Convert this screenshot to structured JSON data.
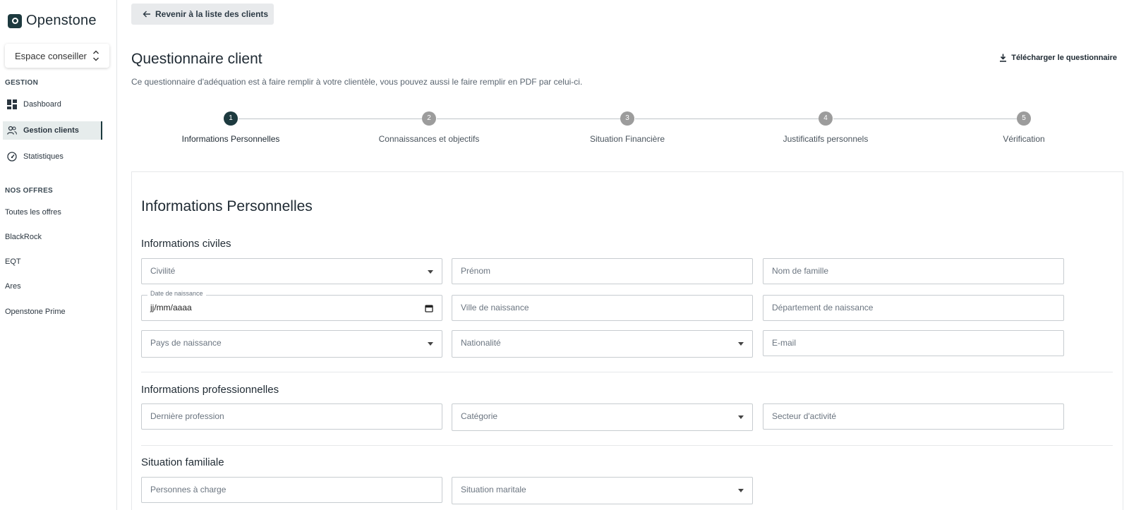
{
  "sidebar": {
    "logo": "Openstone",
    "space_select": "Espace conseiller",
    "section_gestion": "GESTION",
    "nav": [
      {
        "label": "Dashboard",
        "icon": "dashboard-icon"
      },
      {
        "label": "Gestion clients",
        "icon": "users-icon",
        "active": true
      },
      {
        "label": "Statistiques",
        "icon": "gauge-icon"
      }
    ],
    "section_offres": "NOS OFFRES",
    "offers": [
      "Toutes les offres",
      "BlackRock",
      "EQT",
      "Ares",
      "Openstone Prime"
    ]
  },
  "header": {
    "back_label": "Revenir à la liste des clients",
    "title": "Questionnaire client",
    "description": "Ce questionnaire d'adéquation est à faire remplir à votre clientèle, vous pouvez aussi le faire remplir en PDF par celui-ci.",
    "download_label": "Télécharger le questionnaire"
  },
  "stepper": {
    "steps": [
      {
        "num": "1",
        "label": "Informations Personnelles"
      },
      {
        "num": "2",
        "label": "Connaissances et objectifs"
      },
      {
        "num": "3",
        "label": "Situation Financière"
      },
      {
        "num": "4",
        "label": "Justificatifs personnels"
      },
      {
        "num": "5",
        "label": "Vérification"
      }
    ],
    "active_step": 1
  },
  "form": {
    "title": "Informations Personnelles",
    "civil": {
      "title": "Informations civiles",
      "civilite": "Civilité",
      "prenom": "Prénom",
      "nom": "Nom de famille",
      "date_label": "Date de naissance",
      "date_value": "jj/mm/aaaa",
      "ville": "Ville de naissance",
      "departement": "Département de naissance",
      "pays": "Pays de naissance",
      "nationalite": "Nationalité",
      "email": "E-mail"
    },
    "pro": {
      "title": "Informations professionnelles",
      "profession": "Dernière profession",
      "categorie": "Catégorie",
      "secteur": "Secteur d'activité"
    },
    "family": {
      "title": "Situation familiale",
      "personnes": "Personnes à charge",
      "situation": "Situation maritale"
    }
  }
}
